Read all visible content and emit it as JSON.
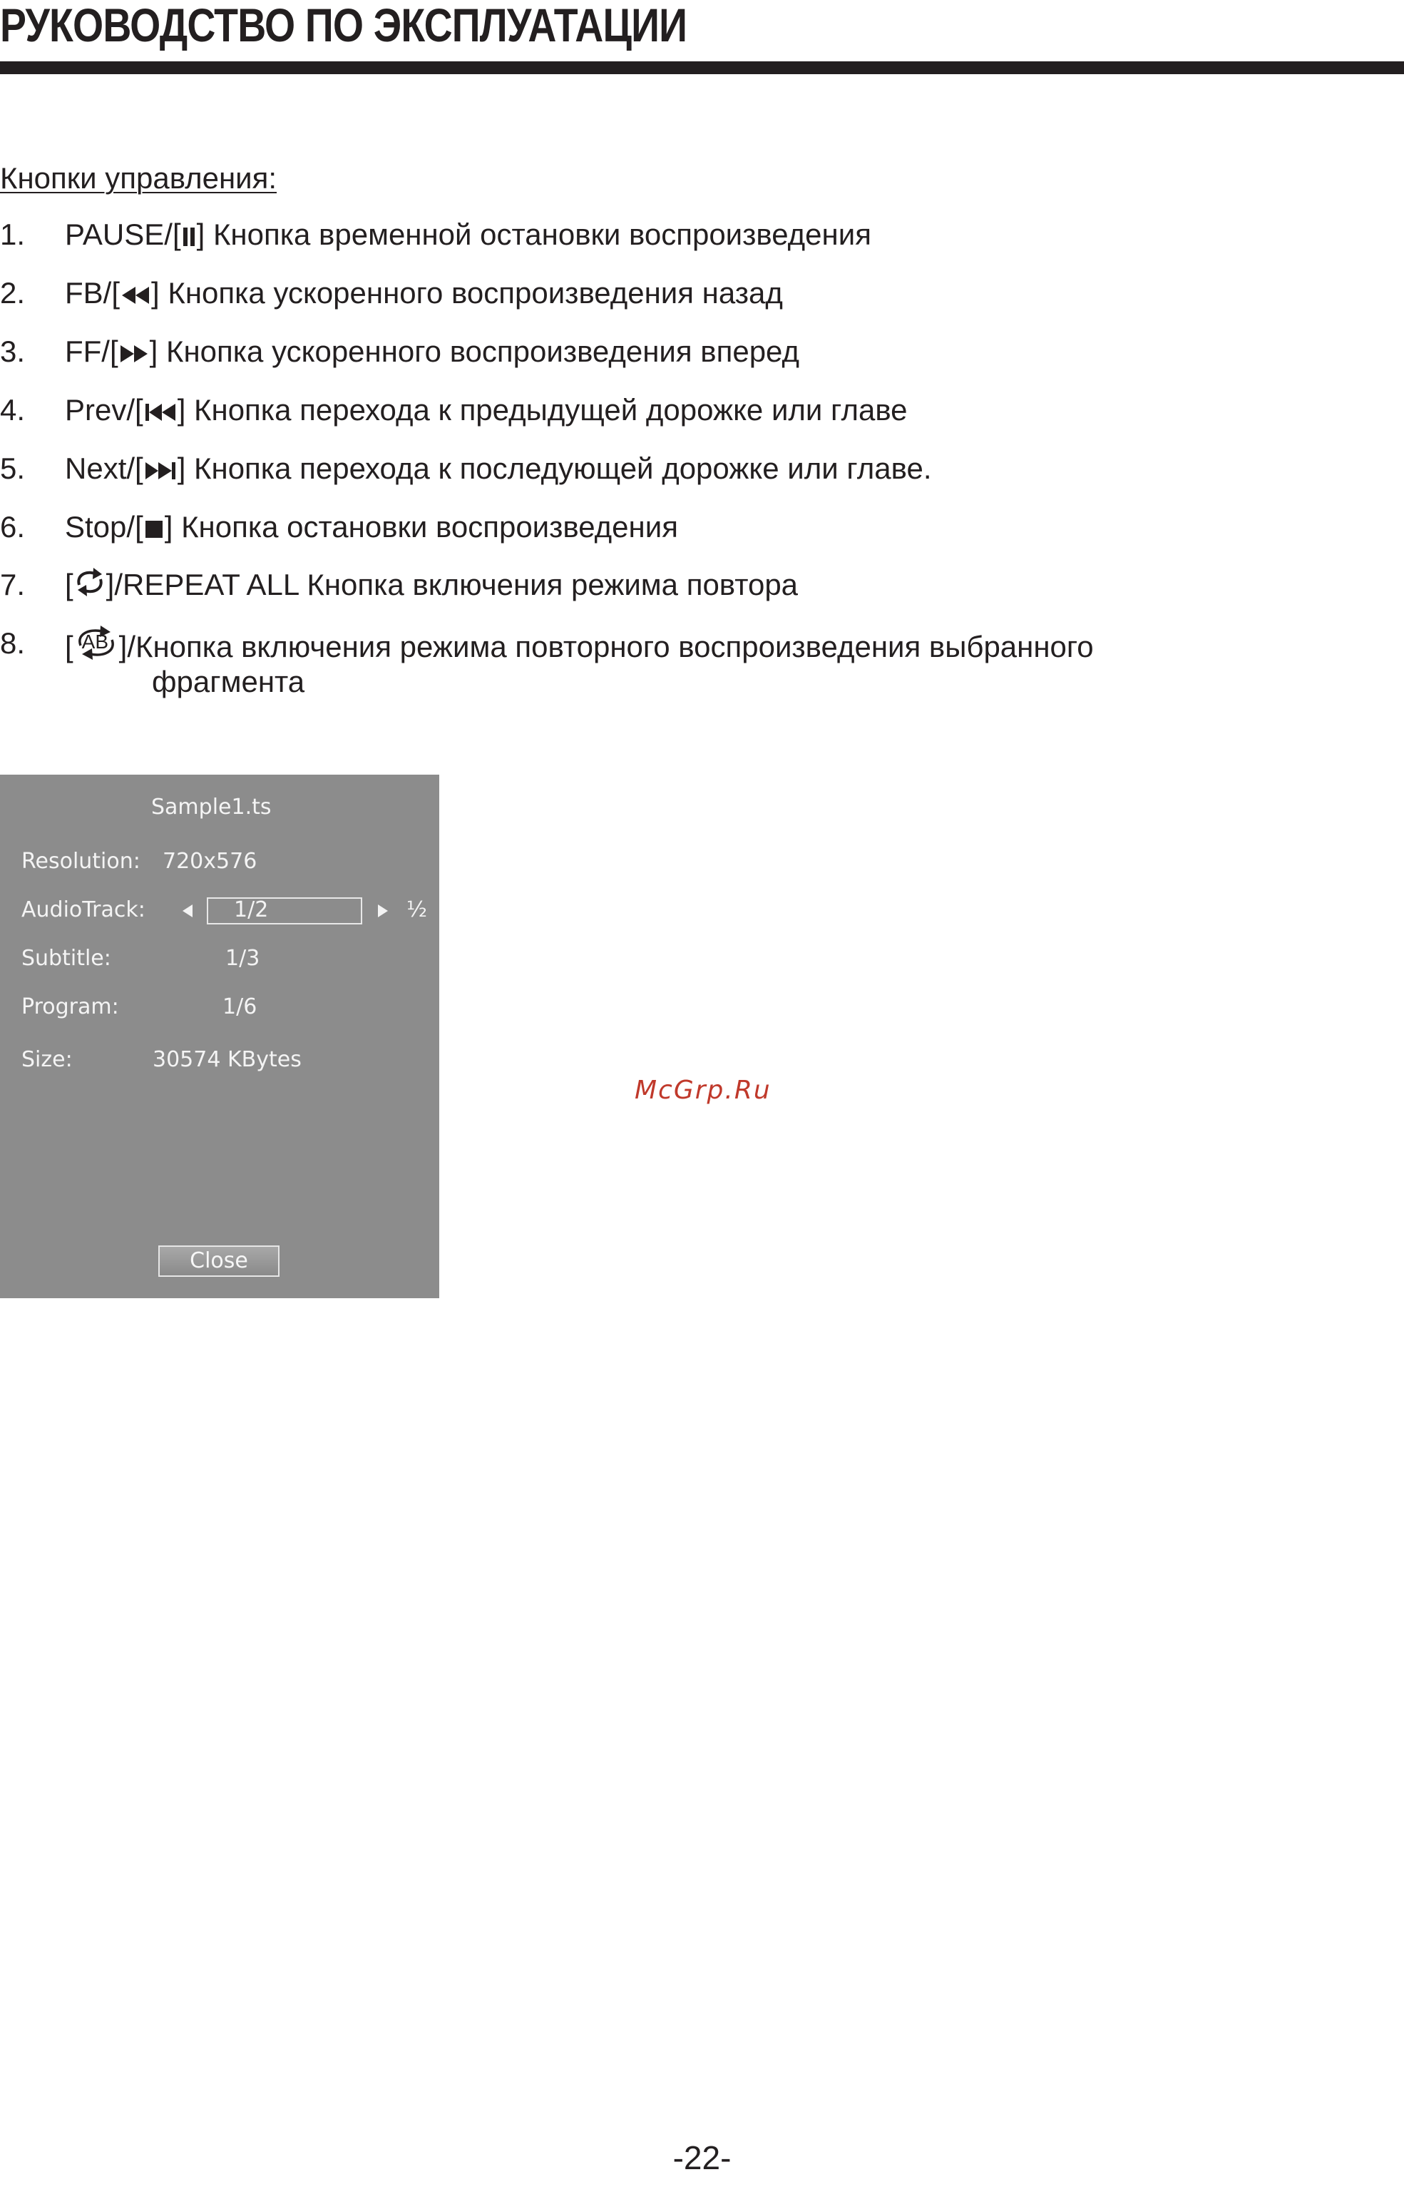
{
  "header": {
    "title": "РУКОВОДСТВО ПО ЭКСПЛУАТАЦИИ"
  },
  "controls": {
    "heading": "Кнопки управления:",
    "items": [
      {
        "num": "1.",
        "pre": "PAUSE/[",
        "icon": "pause-icon",
        "post": "] Кнопка временной остановки воспроизведения"
      },
      {
        "num": "2.",
        "pre": "FB/[",
        "icon": "fast-backward-icon",
        "post": "] Кнопка ускоренного воспроизведения назад"
      },
      {
        "num": "3.",
        "pre": "FF/[",
        "icon": "fast-forward-icon",
        "post": "] Кнопка ускоренного воспроизведения вперед"
      },
      {
        "num": "4.",
        "pre": "Prev/[",
        "icon": "skip-previous-icon",
        "post": "] Кнопка перехода к предыдущей дорожке или главе"
      },
      {
        "num": "5.",
        "pre": "Next/[",
        "icon": "skip-next-icon",
        "post": "] Кнопка перехода к последующей дорожке или главе."
      },
      {
        "num": "6.",
        "pre": "Stop/[",
        "icon": "stop-icon",
        "post": "] Кнопка остановки воспроизведения"
      },
      {
        "num": "7.",
        "pre": "[",
        "icon": "repeat-icon",
        "post": "]/REPEAT ALL Кнопка включения режима повтора"
      },
      {
        "num": "8.",
        "pre": "[",
        "icon": "repeat-ab-icon",
        "post": "]/Кнопка включения режима повторного воспроизведения выбранного",
        "continuation": "фрагмента"
      }
    ],
    "ab_icon_label": "AB"
  },
  "osd": {
    "file_name": "Sample1.ts",
    "resolution_label": "Resolution:",
    "resolution_value": "720x576",
    "audiotrack_label": "AudioTrack:",
    "audiotrack_value": "1/2",
    "audiotrack_extra": "½",
    "subtitle_label": "Subtitle:",
    "subtitle_value": "1/3",
    "program_label": "Program:",
    "program_value": "1/6",
    "size_label": "Size:",
    "size_value": "30574 KBytes",
    "close_label": "Close",
    "background_color": "#8c8c8c"
  },
  "watermark": "McGrp.Ru",
  "footer": {
    "page_number": "-22-"
  }
}
